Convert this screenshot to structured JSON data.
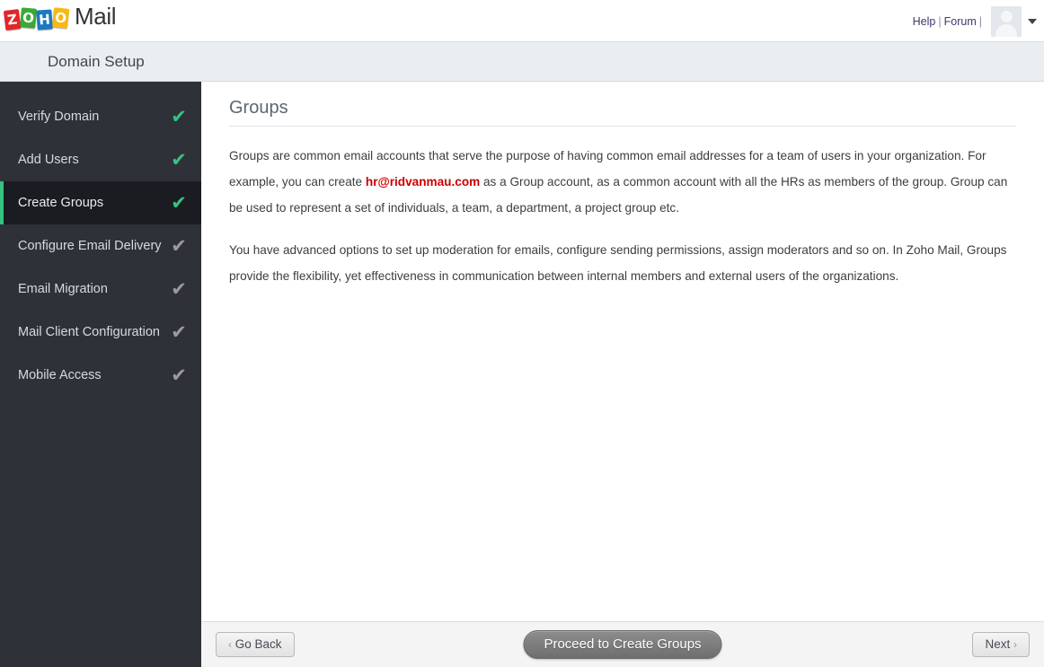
{
  "topbar": {
    "logo": {
      "cubes": [
        "Z",
        "O",
        "H",
        "O"
      ],
      "product": "Mail",
      "colors": {
        "z": "#e42527",
        "o1": "#3aa935",
        "h": "#1c79c0",
        "o2": "#f9b713"
      }
    },
    "help_label": "Help",
    "separator1": "|",
    "forum_label": "Forum",
    "separator2": "|",
    "avatar_icon": "user-avatar-icon",
    "caret_icon": "chevron-down-icon"
  },
  "subheader": {
    "title": "Domain Setup"
  },
  "sidebar": {
    "items": [
      {
        "label": "Verify Domain",
        "status": "done",
        "check_icon": "check-icon",
        "active": false
      },
      {
        "label": "Add Users",
        "status": "done",
        "check_icon": "check-icon",
        "active": false
      },
      {
        "label": "Create Groups",
        "status": "done",
        "check_icon": "check-icon",
        "active": true
      },
      {
        "label": "Configure Email Delivery",
        "status": "pending",
        "check_icon": "check-icon",
        "active": false
      },
      {
        "label": "Email Migration",
        "status": "pending",
        "check_icon": "check-icon",
        "active": false
      },
      {
        "label": "Mail Client Configuration",
        "status": "pending",
        "check_icon": "check-icon",
        "active": false
      },
      {
        "label": "Mobile Access",
        "status": "pending",
        "check_icon": "check-icon",
        "active": false
      }
    ],
    "done_color": "#35c380",
    "pending_color": "#9b9b9b",
    "active_accent_color": "#35c380"
  },
  "main": {
    "title": "Groups",
    "paragraph1_part1": "Groups are common email accounts that serve the purpose of having common email addresses for a team of users in your organization. For example, you can create ",
    "paragraph1_email": "hr@ridvanmau.com",
    "paragraph1_part2": " as a Group account, as a common account with all the HRs as members of the group. Group can be used to represent a set of individuals, a team, a department, a project group etc.",
    "paragraph2": "You have advanced options to set up moderation for emails, configure sending permissions, assign moderators and so on. In Zoho Mail, Groups provide the flexibility, yet effectiveness in communication between internal members and external users of the organizations.",
    "email_color": "#cc0000"
  },
  "footer": {
    "go_back_label": "Go Back",
    "go_back_icon": "chevron-left-icon",
    "proceed_label": "Proceed to Create Groups",
    "next_label": "Next",
    "next_icon": "chevron-right-icon"
  }
}
